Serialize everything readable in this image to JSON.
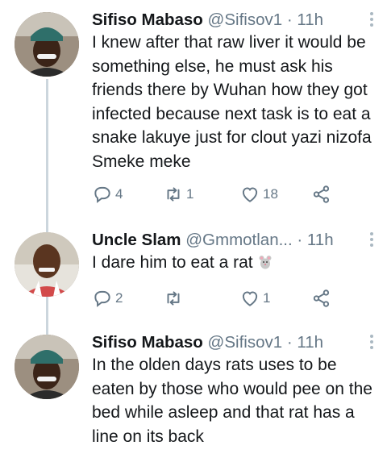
{
  "tweets": [
    {
      "name": "Sifiso Mabaso",
      "handle": "@Sifisov1",
      "dot": "·",
      "time": "11h",
      "text": "I knew after that raw liver it would be something else, he must ask his friends there by Wuhan how they got infected because next task is to eat a snake lakuye just for clout yazi nizofa Smeke meke",
      "replies": "4",
      "retweets": "1",
      "likes": "18"
    },
    {
      "name": "Uncle Slam",
      "handle": "@Gmmotlan...",
      "dot": "·",
      "time": "11h",
      "text": "I dare him to eat a rat",
      "emoji": "rat-emoji",
      "replies": "2",
      "retweets": "",
      "likes": "1"
    },
    {
      "name": "Sifiso Mabaso",
      "handle": "@Sifisov1",
      "dot": "·",
      "time": "11h",
      "text": "In the olden days rats uses to be eaten by those who would pee on the bed while asleep and that rat has a line on its back"
    }
  ],
  "colors": {
    "text": "#14171a",
    "secondary": "#657786",
    "thread_line": "#ccd6dd"
  },
  "icons": [
    "reply-icon",
    "retweet-icon",
    "like-icon",
    "share-icon",
    "more-icon"
  ]
}
